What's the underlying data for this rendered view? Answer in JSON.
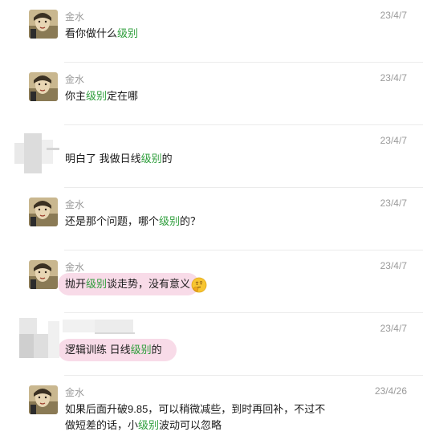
{
  "messages": [
    {
      "sender": "金水",
      "date": "23/4/7",
      "segments": [
        "看你做什么",
        "级别",
        ""
      ]
    },
    {
      "sender": "金水",
      "date": "23/4/7",
      "segments": [
        "你主",
        "级别",
        "定在哪"
      ]
    },
    {
      "sender": "",
      "date": "23/4/7",
      "segments": [
        "明白了 我做日线",
        "级别",
        "的"
      ]
    },
    {
      "sender": "金水",
      "date": "23/4/7",
      "segments": [
        "还是那个问题，哪个",
        "级别",
        "的？"
      ]
    },
    {
      "sender": "金水",
      "date": "23/4/7",
      "segments": [
        "抛开",
        "级别",
        "谈走势，没有意义"
      ]
    },
    {
      "sender": "",
      "date": "23/4/7",
      "segments": [
        "逻辑训练 日线",
        "级别",
        "的"
      ]
    },
    {
      "sender": "金水",
      "date": "23/4/26",
      "line1": "如果后面升破9.85，可以稍微减些，到时再回补，不过不",
      "segments": [
        "做短差的话，小",
        "级别",
        "波动可以忽略"
      ]
    }
  ],
  "icons": {
    "avatar": "portrait-avatar-icon",
    "emoji": "thinking-face-emoji-icon"
  },
  "colors": {
    "keyword": "#2e9e3b",
    "highlight": "#f6cfe0",
    "meta": "#9a9a9a"
  }
}
